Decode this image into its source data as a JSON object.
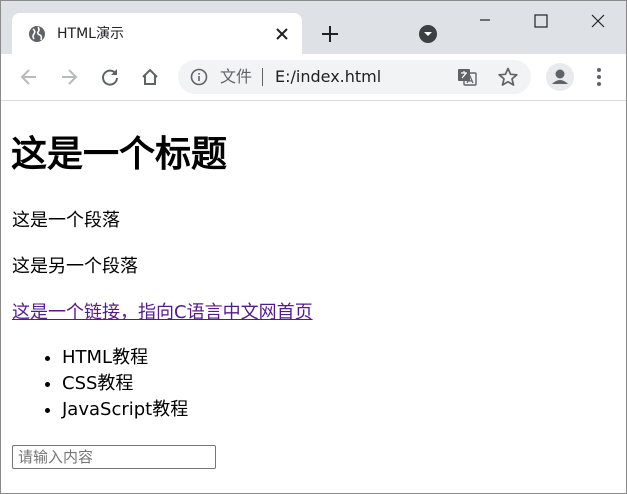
{
  "browser": {
    "tab": {
      "title": "HTML演示"
    },
    "address": {
      "scheme_label": "文件",
      "url": "E:/index.html"
    }
  },
  "page": {
    "heading": "这是一个标题",
    "paragraphs": [
      "这是一个段落",
      "这是另一个段落"
    ],
    "link_text": "这是一个链接，指向C语言中文网首页",
    "list_items": [
      "HTML教程",
      "CSS教程",
      "JavaScript教程"
    ],
    "input": {
      "placeholder": "请输入内容",
      "value": ""
    }
  },
  "colors": {
    "tabstrip": "#dee1e6",
    "omnibox": "#f1f3f4",
    "visited_link": "#551a8b",
    "icon_gray": "#5f6368"
  }
}
